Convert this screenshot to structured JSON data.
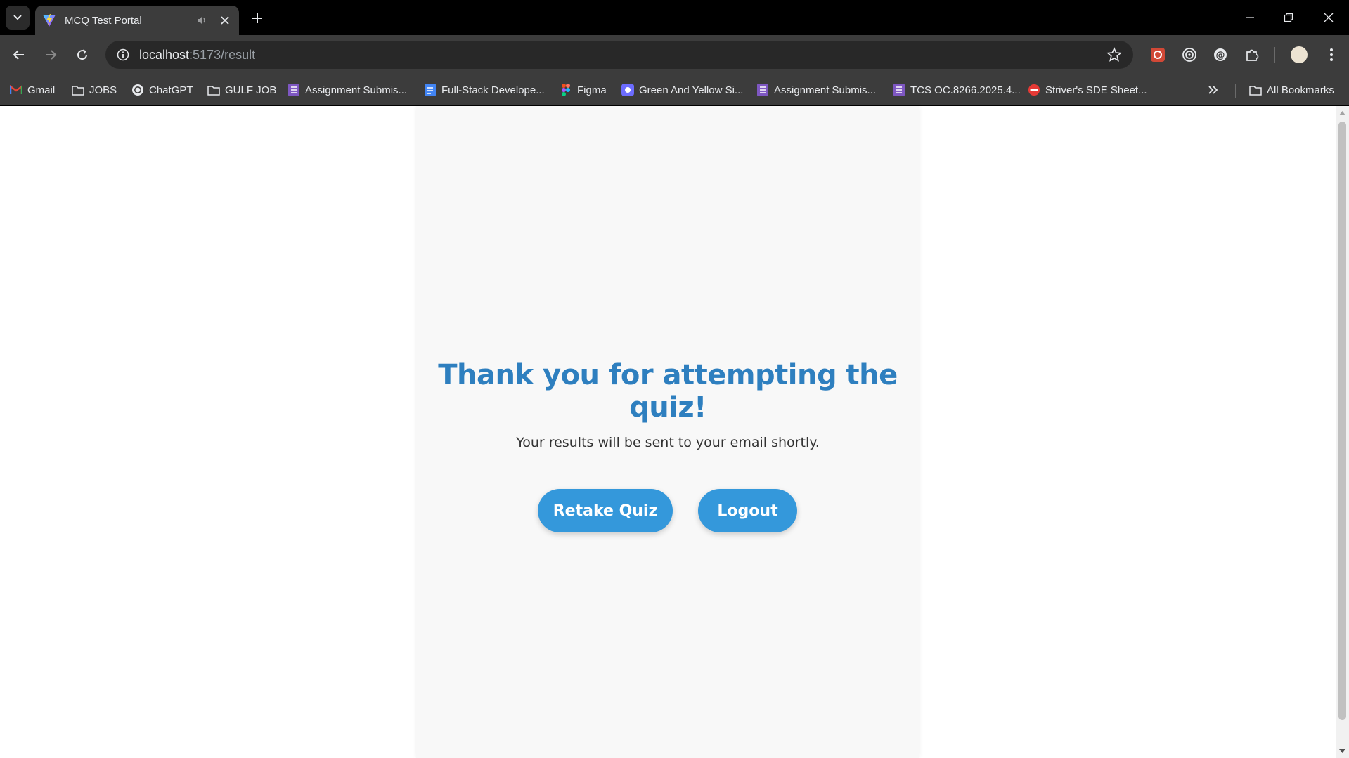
{
  "browser": {
    "tab_title": "MCQ Test Portal",
    "url_host": "localhost",
    "url_path": ":5173/result",
    "bookmarks": [
      {
        "label": "Gmail",
        "icon": "gmail-icon"
      },
      {
        "label": "JOBS",
        "icon": "folder-icon"
      },
      {
        "label": "ChatGPT",
        "icon": "chatgpt-icon"
      },
      {
        "label": "GULF JOB",
        "icon": "folder-icon"
      },
      {
        "label": "Assignment Submis...",
        "icon": "form-icon"
      },
      {
        "label": "Full-Stack Develope...",
        "icon": "doc-icon"
      },
      {
        "label": "Figma",
        "icon": "figma-icon"
      },
      {
        "label": "Green And Yellow Si...",
        "icon": "canva-icon"
      },
      {
        "label": "Assignment Submis...",
        "icon": "form-icon"
      },
      {
        "label": "TCS OC.8266.2025.4...",
        "icon": "form-icon"
      },
      {
        "label": "Striver's SDE Sheet...",
        "icon": "tuf-icon"
      }
    ],
    "all_bookmarks": "All Bookmarks"
  },
  "page": {
    "heading": "Thank you for attempting the quiz!",
    "subtext": "Your results will be sent to your email shortly.",
    "retake_label": "Retake Quiz",
    "logout_label": "Logout"
  },
  "colors": {
    "accent": "#3498db",
    "heading": "#2e7fbf"
  }
}
